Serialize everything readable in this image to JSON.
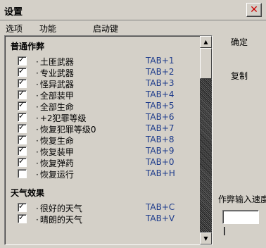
{
  "window": {
    "title": "设置",
    "close_icon": "close-icon"
  },
  "menu": {
    "items": [
      "选项",
      "功能",
      "启动键"
    ]
  },
  "sections": [
    {
      "title": "普通作弊",
      "items": [
        {
          "label": "土匪武器",
          "key": "TAB+1",
          "checked": true
        },
        {
          "label": "专业武器",
          "key": "TAB+2",
          "checked": true
        },
        {
          "label": "怪异武器",
          "key": "TAB+3",
          "checked": true
        },
        {
          "label": "全部装甲",
          "key": "TAB+4",
          "checked": true
        },
        {
          "label": "全部生命",
          "key": "TAB+5",
          "checked": true
        },
        {
          "label": "+2犯罪等级",
          "key": "TAB+6",
          "checked": true
        },
        {
          "label": "恢复犯罪等级0",
          "key": "TAB+7",
          "checked": true
        },
        {
          "label": "恢复生命",
          "key": "TAB+8",
          "checked": true
        },
        {
          "label": "恢复装甲",
          "key": "TAB+9",
          "checked": true
        },
        {
          "label": "恢复弹药",
          "key": "TAB+0",
          "checked": true
        },
        {
          "label": "恢复运行",
          "key": "TAB+H",
          "checked": false
        }
      ]
    },
    {
      "title": "天气效果",
      "items": [
        {
          "label": "很好的天气",
          "key": "TAB+C",
          "checked": true
        },
        {
          "label": "晴朗的天气",
          "key": "TAB+V",
          "checked": true
        }
      ]
    }
  ],
  "buttons": {
    "ok": "确定",
    "copy": "复制"
  },
  "speed": {
    "label": "作弊输入速度"
  }
}
